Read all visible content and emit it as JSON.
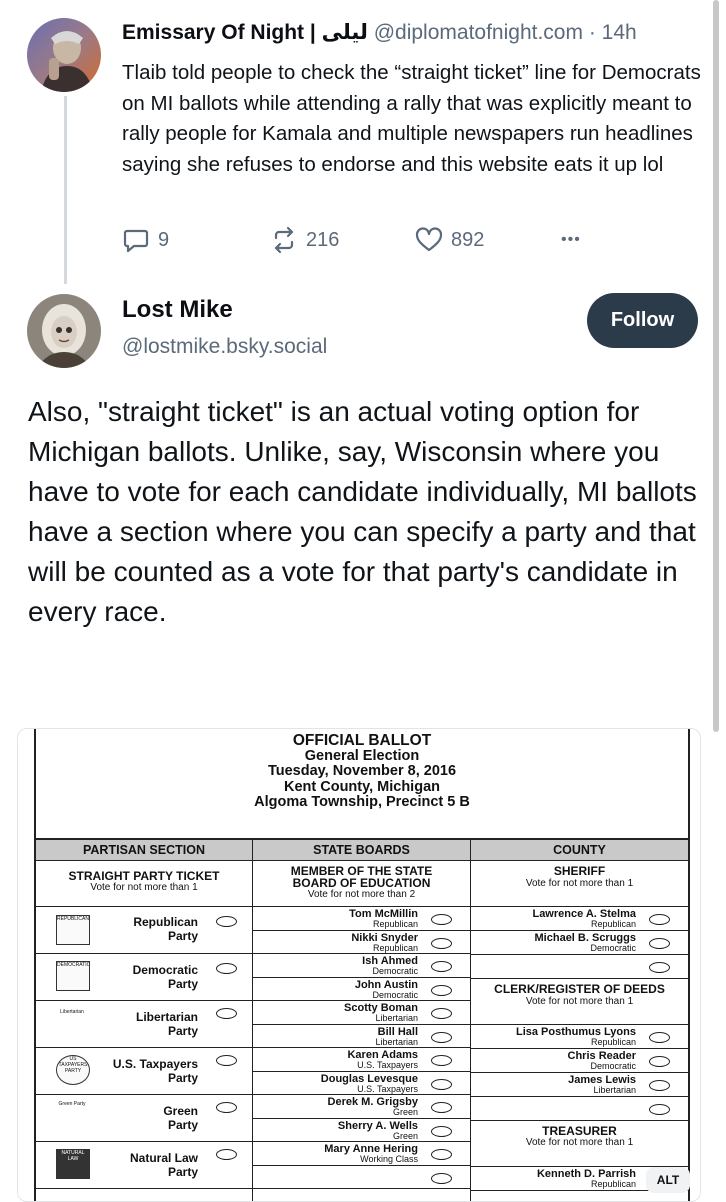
{
  "post1": {
    "display_name": "Emissary Of Night | ليلى",
    "handle": "@diplomatofnight.com",
    "time": "· 14h",
    "text": "Tlaib told people to check the “straight ticket” line for Democrats on MI ballots while attending a rally that was explicitly meant to rally people for Kamala and multiple newspapers run headlines saying she refuses to endorse and this website eats it up lol",
    "replies": "9",
    "reposts": "216",
    "likes": "892",
    "more": "•••"
  },
  "post2": {
    "display_name": "Lost Mike",
    "handle": "@lostmike.bsky.social",
    "follow_label": "Follow",
    "text": "Also, \"straight ticket\" is an actual voting option for Michigan ballots.  Unlike, say, Wisconsin where you have to vote for each candidate individually, MI ballots have a section where you can specify a party and that will be counted as a vote for that party's candidate in every race."
  },
  "image_alt_badge": "ALT",
  "ballot": {
    "title": "OFFICIAL BALLOT",
    "lines": [
      "General Election",
      "Tuesday, November 8, 2016",
      "Kent County, Michigan",
      "Algoma Township, Precinct 5 B"
    ],
    "columns": [
      "PARTISAN SECTION",
      "STATE BOARDS",
      "COUNTY"
    ],
    "straight_ticket": {
      "title": "STRAIGHT PARTY TICKET",
      "sub": "Vote for not more than 1",
      "parties": [
        {
          "line1": "Republican",
          "line2": "Party",
          "logo": "REPUBLICAN"
        },
        {
          "line1": "Democratic",
          "line2": "Party",
          "logo": "DEMOCRATIC"
        },
        {
          "line1": "Libertarian",
          "line2": "Party",
          "logo": "Libertarian"
        },
        {
          "line1": "U.S. Taxpayers",
          "line2": "Party",
          "logo": "US TAXPAYERS PARTY"
        },
        {
          "line1": "Green",
          "line2": "Party",
          "logo": "Green Party"
        },
        {
          "line1": "Natural Law",
          "line2": "Party",
          "logo": "NATURAL LAW"
        }
      ]
    },
    "state_board": {
      "title1": "MEMBER OF THE STATE",
      "title2": "BOARD OF EDUCATION",
      "sub": "Vote for not more than 2",
      "candidates": [
        {
          "name": "Tom McMillin",
          "party": "Republican"
        },
        {
          "name": "Nikki Snyder",
          "party": "Republican"
        },
        {
          "name": "Ish Ahmed",
          "party": "Democratic"
        },
        {
          "name": "John Austin",
          "party": "Democratic"
        },
        {
          "name": "Scotty Boman",
          "party": "Libertarian"
        },
        {
          "name": "Bill Hall",
          "party": "Libertarian"
        },
        {
          "name": "Karen Adams",
          "party": "U.S. Taxpayers"
        },
        {
          "name": "Douglas Levesque",
          "party": "U.S. Taxpayers"
        },
        {
          "name": "Derek M. Grigsby",
          "party": "Green"
        },
        {
          "name": "Sherry A. Wells",
          "party": "Green"
        },
        {
          "name": "Mary Anne Hering",
          "party": "Working Class"
        },
        {
          "name": "",
          "party": ""
        }
      ]
    },
    "county": {
      "sheriff": {
        "title": "SHERIFF",
        "sub": "Vote for not more than 1",
        "candidates": [
          {
            "name": "Lawrence A. Stelma",
            "party": "Republican"
          },
          {
            "name": "Michael B. Scruggs",
            "party": "Democratic"
          },
          {
            "name": "",
            "party": ""
          }
        ]
      },
      "clerk": {
        "title": "CLERK/REGISTER OF DEEDS",
        "sub": "Vote for not more than 1",
        "candidates": [
          {
            "name": "Lisa Posthumus Lyons",
            "party": "Republican"
          },
          {
            "name": "Chris Reader",
            "party": "Democratic"
          },
          {
            "name": "James Lewis",
            "party": "Libertarian"
          },
          {
            "name": "",
            "party": ""
          }
        ]
      },
      "treasurer": {
        "title": "TREASURER",
        "sub": "Vote for not more than 1",
        "candidates": [
          {
            "name": "Kenneth D. Parrish",
            "party": "Republican"
          }
        ]
      }
    }
  }
}
